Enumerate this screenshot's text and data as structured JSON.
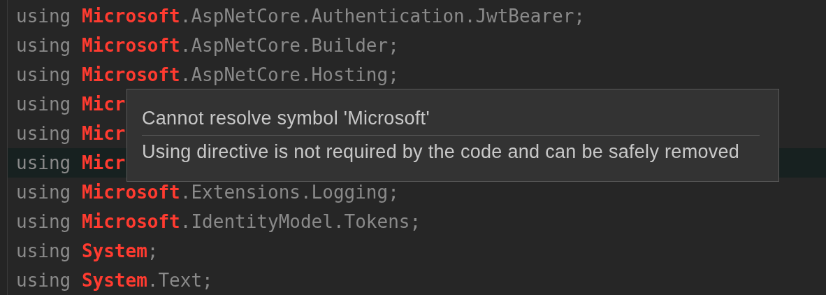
{
  "editor": {
    "lines": [
      {
        "keyword": "using",
        "namespace": "Microsoft",
        "rest": ".AspNetCore.Authentication.JwtBearer;",
        "highlighted": false
      },
      {
        "keyword": "using",
        "namespace": "Microsoft",
        "rest": ".AspNetCore.Builder;",
        "highlighted": false
      },
      {
        "keyword": "using",
        "namespace": "Microsoft",
        "rest": ".AspNetCore.Hosting;",
        "highlighted": false
      },
      {
        "keyword": "using",
        "namespace": "Micr",
        "highlighted": false
      },
      {
        "keyword": "using",
        "namespace": "Micr",
        "highlighted": false
      },
      {
        "keyword": "using",
        "namespace": "Micr",
        "highlighted": true
      },
      {
        "keyword": "using",
        "namespace": "Microsoft",
        "rest": ".Extensions.Logging;",
        "highlighted": false
      },
      {
        "keyword": "using",
        "namespace": "Microsoft",
        "rest": ".IdentityModel.Tokens;",
        "highlighted": false
      },
      {
        "keyword": "using",
        "namespace": "System",
        "rest": ";",
        "highlighted": false
      },
      {
        "keyword": "using",
        "namespace": "System",
        "rest": ".Text;",
        "highlighted": false
      }
    ]
  },
  "tooltip": {
    "title": "Cannot resolve symbol 'Microsoft'",
    "message": "Using directive is not required by the code and can be safely removed"
  }
}
